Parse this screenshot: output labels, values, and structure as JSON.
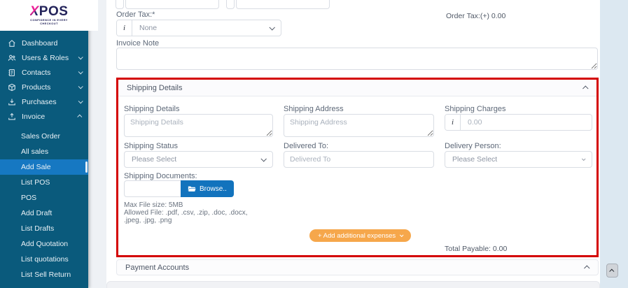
{
  "logo": {
    "brand_x": "X",
    "brand_rest": "POS",
    "tagline_line1": "CONFIDENCE IN EVERY",
    "tagline_line2": "CHECKOUT"
  },
  "sidebar": {
    "items": [
      {
        "label": "Dashboard",
        "icon": "home-icon"
      },
      {
        "label": "Users & Roles",
        "icon": "users-icon"
      },
      {
        "label": "Contacts",
        "icon": "contacts-icon"
      },
      {
        "label": "Products",
        "icon": "package-icon"
      },
      {
        "label": "Purchases",
        "icon": "download-icon"
      },
      {
        "label": "Invoice",
        "icon": "upload-icon"
      }
    ],
    "invoice_submenu": [
      {
        "label": "Sales Order"
      },
      {
        "label": "All sales"
      },
      {
        "label": "Add Sale",
        "active": true
      },
      {
        "label": "List POS"
      },
      {
        "label": "POS"
      },
      {
        "label": "Add Draft"
      },
      {
        "label": "List Drafts"
      },
      {
        "label": "Add Quotation"
      },
      {
        "label": "List quotations"
      },
      {
        "label": "List Sell Return"
      }
    ]
  },
  "order_tax": {
    "label": "Order Tax:*",
    "selected": "None",
    "info_icon": "i",
    "summary": "Order Tax:(+) 0.00"
  },
  "invoice_note": {
    "label": "Invoice Note",
    "value": ""
  },
  "shipping": {
    "title": "Shipping Details",
    "details": {
      "label": "Shipping Details",
      "placeholder": "Shipping Details"
    },
    "address": {
      "label": "Shipping Address",
      "placeholder": "Shipping Address"
    },
    "charges": {
      "label": "Shipping Charges",
      "placeholder": "0.00",
      "info_icon": "i"
    },
    "status": {
      "label": "Shipping Status",
      "selected": "Please Select"
    },
    "delivered_to": {
      "label": "Delivered To:",
      "placeholder": "Delivered To"
    },
    "delivery_person": {
      "label": "Delivery Person:",
      "selected": "Please Select"
    },
    "documents": {
      "label": "Shipping Documents:",
      "browse_label": "Browse..",
      "max_size": "Max File size: 5MB",
      "allowed_line1": "Allowed File: .pdf, .csv, .zip, .doc, .docx,",
      "allowed_line2": ".jpeg, .jpg, .png"
    }
  },
  "actions": {
    "add_expenses_label": "+ Add additional expenses"
  },
  "totals": {
    "total_payable": "Total Payable: 0.00"
  },
  "payment": {
    "title": "Payment Accounts"
  },
  "colors": {
    "sidebar_bg": "#0a5a7c",
    "active_item_bg": "#1678c2",
    "browse_button": "#1273bd",
    "add_expenses_button": "#f6a74b",
    "highlight_outline": "#d40000"
  }
}
